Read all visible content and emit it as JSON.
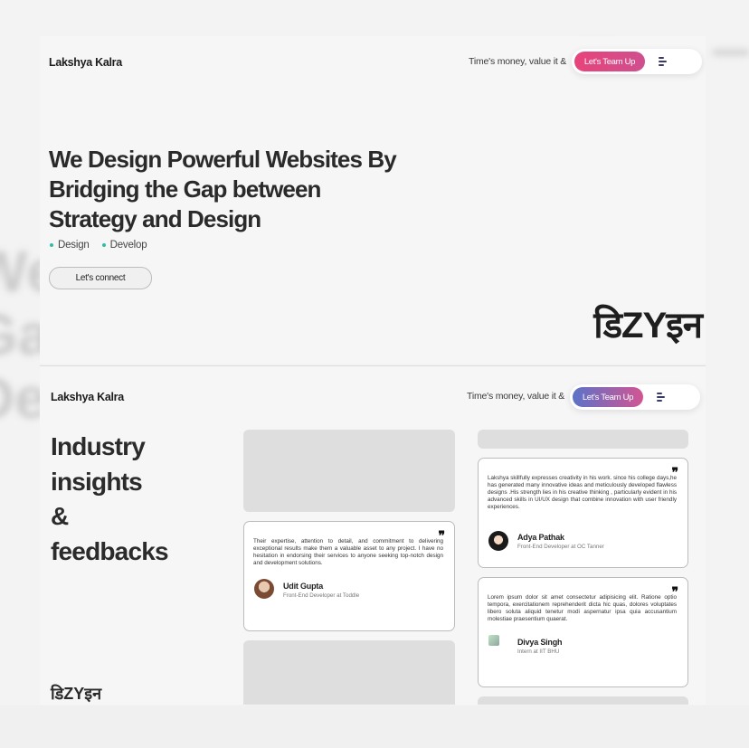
{
  "top": {
    "brand": "Lakshya Kalra",
    "tagline": "Time's money, value it &",
    "cta_label": "Let's Team Up",
    "hero_lines": [
      "We Design Powerful Websites By",
      "Bridging the Gap between",
      "Strategy and Design"
    ],
    "bullets": [
      "Design",
      "Develop"
    ],
    "connect_label": "Let's connect",
    "logo_text": "डिZYइन"
  },
  "bottom": {
    "brand": "Lakshya Kalra",
    "tagline": "Time's money, value it &",
    "cta_label": "Let's Team Up",
    "section_title_lines": [
      "Industry",
      "insights",
      "&",
      "feedbacks"
    ],
    "logo_text": "डिZYइन"
  },
  "testimonials": [
    {
      "text": "Their expertise, attention to detail, and commitment to delivering exceptional results make them a valuable asset to any project. I have no hesitation in endorsing their services to anyone seeking top-notch design and development solutions.",
      "name": "Udit Gupta",
      "role": "Front-End Developer at Toddle"
    },
    {
      "text": "Lakshya skillfully expresses creativity in his work. since his college days,he has generated many innovative ideas and meticulously developed flawless designs .His strength lies in his creative thinking , particularly evident in his advanced skills in UI/UX design that combine innovation with user friendly experiences.",
      "name": "Adya Pathak",
      "role": "Front-End Developer at OC Tanner"
    },
    {
      "text": "Lorem ipsum dolor sit amet consectetur adipisicing elit. Ratione optio tempora, exercitationem reprehenderit dicta hic quas, dolores voluptates libero soluta aliquid tenetur modi aspernatur ipsa quia accusantium molestiae praesentium quaerat.",
      "name": "Divya Singh",
      "role": "Intern at IIT BHU"
    }
  ],
  "colors": {
    "cta_gradient_top": [
      "#e8437a",
      "#cf4f8f"
    ],
    "cta_gradient_bottom": [
      "#5b73c8",
      "#d25592"
    ],
    "bullet_dot": "#2bbfa7"
  },
  "icons": [
    "menu-icon",
    "quote-icon",
    "avatar"
  ]
}
